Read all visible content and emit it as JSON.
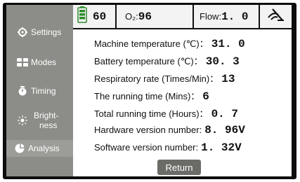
{
  "sidebar": {
    "items": [
      {
        "label": "Settings",
        "icon": "gear-icon"
      },
      {
        "label": "Modes",
        "icon": "grid-icon"
      },
      {
        "label": "Timing",
        "icon": "timer-icon"
      },
      {
        "label_line1": "Bright-",
        "label_line2": "ness",
        "icon": "sun-icon"
      },
      {
        "label": "Analysis",
        "icon": "pie-chart-icon"
      }
    ]
  },
  "status": {
    "battery_value": "60",
    "o2_label": "O₂:",
    "o2_value": "96",
    "flow_label": "Flow:",
    "flow_value": "1. 0",
    "status_icon": "no-signal-icon"
  },
  "info": {
    "rows": [
      {
        "label": "Machine temperature (℃)：",
        "value": "31. 0"
      },
      {
        "label": "Battery temperature (℃)：",
        "value": "30. 3"
      },
      {
        "label": "Respiratory rate (Times/Min)：",
        "value": "13"
      },
      {
        "label": "The running time (Mins)：",
        "value": "6"
      },
      {
        "label": "Total running time (Hours)：",
        "value": "0. 7"
      },
      {
        "label": "Hardware version number:",
        "value": "8. 96V"
      },
      {
        "label": "Software version number:",
        "value": "1. 32V"
      }
    ]
  },
  "return_label": "Return",
  "colors": {
    "sidebar": "#8c8c88",
    "button": "#6b6b67",
    "bezel": "#0d0d0d"
  }
}
